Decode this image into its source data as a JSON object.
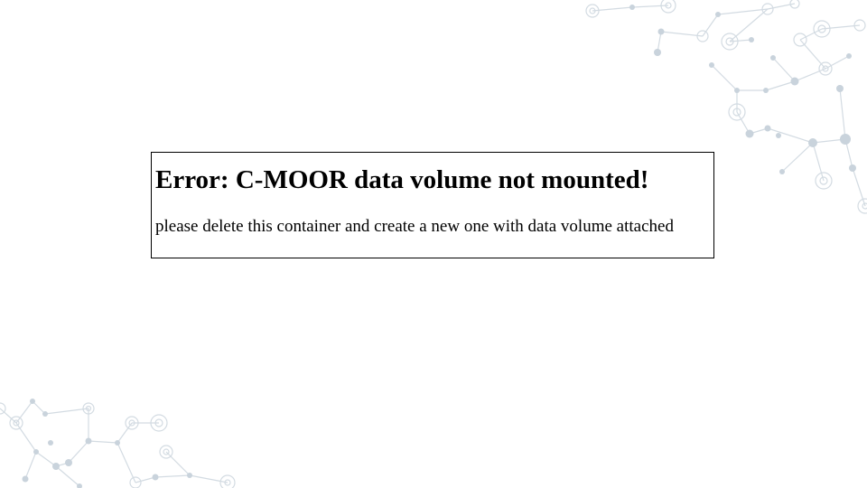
{
  "error": {
    "title": "Error: C-MOOR data volume not mounted!",
    "message": "please delete this container and create a new one with data volume attached"
  },
  "colors": {
    "background": "#ffffff",
    "text": "#000000",
    "border": "#000000",
    "network": "#c9d3dc"
  },
  "decorations": [
    "network-graph-top-right",
    "network-graph-bottom-left"
  ]
}
